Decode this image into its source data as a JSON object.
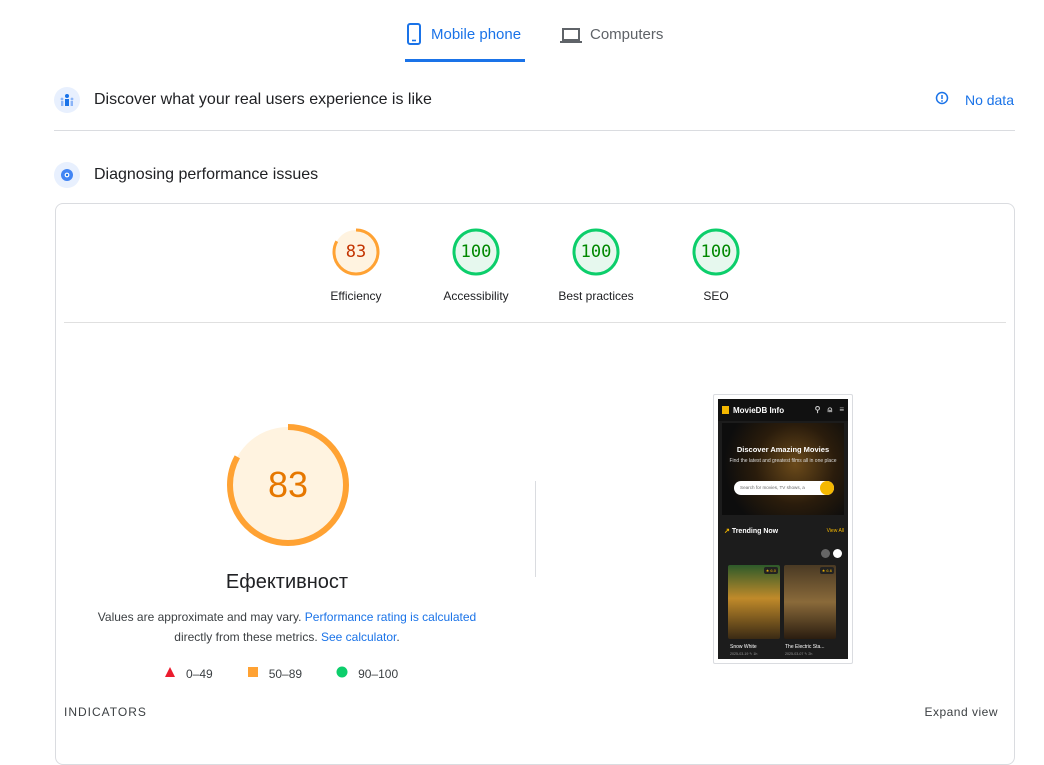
{
  "tabs": [
    {
      "label": "Mobile phone",
      "icon": "smartphone-icon",
      "active": true
    },
    {
      "label": "Computers",
      "icon": "laptop-icon",
      "active": false
    }
  ],
  "field_data": {
    "title": "Discover what your real users experience is like",
    "status": "No data",
    "status_icon": "info-icon"
  },
  "diagnostics": {
    "title": "Diagnosing performance issues"
  },
  "scores": [
    {
      "label": "Efficiency",
      "value": "83",
      "status": "average"
    },
    {
      "label": "Accessibility",
      "value": "100",
      "status": "pass"
    },
    {
      "label": "Best practices",
      "value": "100",
      "status": "pass"
    },
    {
      "label": "SEO",
      "value": "100",
      "status": "pass"
    }
  ],
  "main_score": {
    "value": "83",
    "title": "Ефективност",
    "note_prefix": "Values are approximate and may vary. ",
    "note_link1": "Performance rating is calculated",
    "note_middle": " directly from these metrics. ",
    "note_link2": "See calculator",
    "note_suffix": "."
  },
  "legend": [
    {
      "shape": "triangle",
      "range": "0–49",
      "color": "#eb1c2e"
    },
    {
      "shape": "square",
      "range": "50–89",
      "color": "#ffa233"
    },
    {
      "shape": "circle",
      "range": "90–100",
      "color": "#0cce6b"
    }
  ],
  "screenshot": {
    "site_name": "MovieDB Info",
    "hero_title": "Discover Amazing Movies",
    "hero_subtitle": "Find the latest and greatest films all in one place",
    "search_placeholder": "Search for movies, TV shows, a",
    "section_title": "Trending Now",
    "view_all": "View All",
    "movies": [
      {
        "title": "Snow White",
        "rating": "★ 6.0",
        "meta": "2025-03-19   ✎ 1h"
      },
      {
        "title": "The Electric Sta...",
        "rating": "★ 6.6",
        "meta": "2025-03-07   ✎ 2h"
      }
    ]
  },
  "footer": {
    "indicators": "INDICATORS",
    "expand": "Expand view"
  },
  "colors": {
    "accent": "#1a73e8",
    "average": "#ffa233",
    "pass": "#0cce6b",
    "fail": "#eb1c2e"
  }
}
